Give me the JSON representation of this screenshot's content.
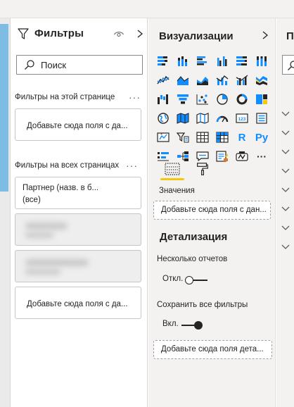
{
  "filters": {
    "title": "Фильтры",
    "search_placeholder": "Поиск",
    "this_page_label": "Фильтры на этой странице",
    "this_page_drop": "Добавьте сюда поля с да...",
    "all_pages_label": "Фильтры на всех страницах",
    "partner_filter_line1": "Партнер (назв. в б...",
    "partner_filter_line2": "(все)",
    "all_pages_drop": "Добавьте сюда поля с да...",
    "more_glyph": "···"
  },
  "visualizations": {
    "title": "Визуализации",
    "icons": [
      "stacked-bar-icon",
      "stacked-column-icon",
      "clustered-bar-icon",
      "clustered-column-icon",
      "100-bar-icon",
      "100-column-icon",
      "line-chart-icon",
      "area-chart-icon",
      "stacked-area-icon",
      "line-column-icon",
      "line-clustered-column-icon",
      "ribbon-chart-icon",
      "waterfall-icon",
      "funnel-icon",
      "scatter-icon",
      "pie-chart-icon",
      "donut-chart-icon",
      "treemap-icon",
      "globe-map-icon",
      "filled-map-icon",
      "shape-map-icon",
      "gauge-icon",
      "card-icon",
      "multi-row-card-icon",
      "kpi-icon",
      "slicer-icon",
      "table-icon",
      "matrix-icon",
      "r-visual-icon",
      "python-visual-icon",
      "key-influencers-icon",
      "decomposition-tree-icon",
      "qa-icon",
      "smart-narrative-icon",
      "paginated-report-icon",
      "more-visuals-icon"
    ],
    "text_icons": {
      "r": "R",
      "py": "Py",
      "more": "···"
    },
    "values_label": "Значения",
    "values_drop": "Добавьте сюда поля с дан...",
    "drillthrough_heading": "Детализация",
    "multi_report_label": "Несколько отчетов",
    "multi_report_state": "Откл.",
    "keep_filters_label": "Сохранить все фильтры",
    "keep_filters_state": "Вкл.",
    "drillthrough_drop": "Добавьте сюда поля дета..."
  },
  "fields": {
    "title_partial": "П"
  },
  "colors": {
    "accent_yellow": "#f2c811",
    "icon_blue": "#118dff",
    "icon_dark": "#252423",
    "canvas_blue": "#7fbce3"
  }
}
